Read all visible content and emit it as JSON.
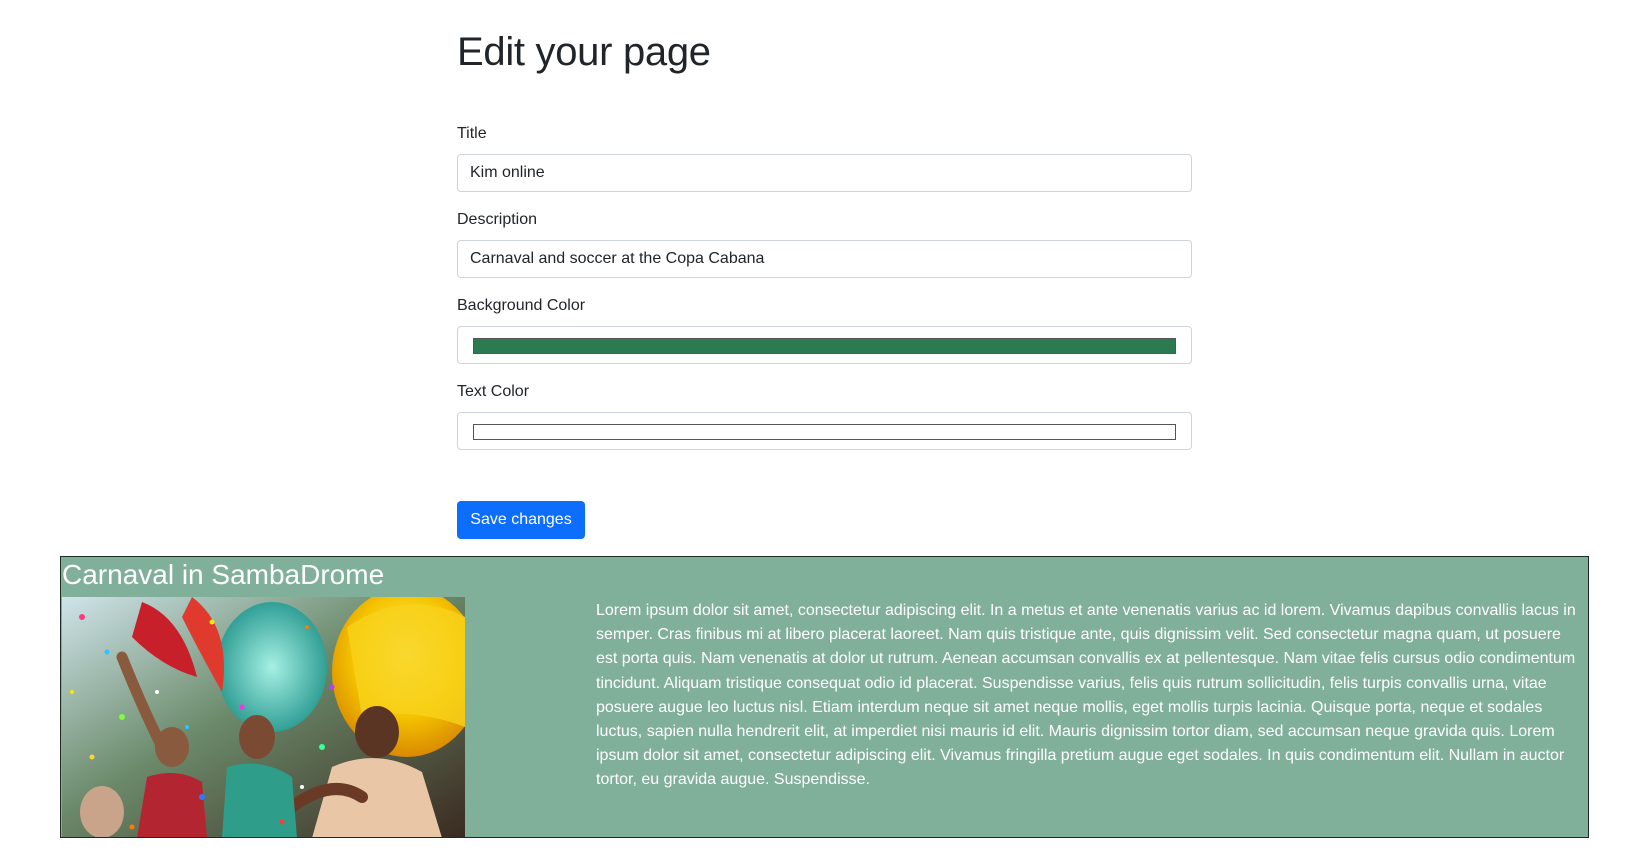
{
  "page": {
    "title": "Edit your page"
  },
  "form": {
    "title_label": "Title",
    "title_value": "Kim online",
    "description_label": "Description",
    "description_value": "Carnaval and soccer at the Copa Cabana",
    "bg_color_label": "Background Color",
    "bg_color_value": "#2b7a50",
    "text_color_label": "Text Color",
    "text_color_value": "#ffffff",
    "save_label": "Save changes"
  },
  "preview": {
    "heading": "Carnaval in SambaDrome",
    "image_label": "carnaval-dancers-photo",
    "background": "#80b09a",
    "text_color": "#ffffff",
    "body": "Lorem ipsum dolor sit amet, consectetur adipiscing elit. In a metus et ante venenatis varius ac id lorem. Vivamus dapibus convallis lacus in semper. Cras finibus mi at libero placerat laoreet. Nam quis tristique ante, quis dignissim velit. Sed consectetur magna quam, ut posuere est porta quis. Nam venenatis at dolor ut rutrum. Aenean accumsan convallis ex at pellentesque. Nam vitae felis cursus odio condimentum tincidunt. Aliquam tristique consequat odio id placerat. Suspendisse varius, felis quis rutrum sollicitudin, felis turpis convallis urna, vitae posuere augue leo luctus nisl. Etiam interdum neque sit amet neque mollis, eget mollis turpis lacinia. Quisque porta, neque et sodales luctus, sapien nulla hendrerit elit, at imperdiet nisi mauris id elit. Mauris dignissim tortor diam, sed accumsan neque gravida quis. Lorem ipsum dolor sit amet, consectetur adipiscing elit. Vivamus fringilla pretium augue eget sodales. In quis condimentum elit. Nullam in auctor tortor, eu gravida augue. Suspendisse."
  }
}
